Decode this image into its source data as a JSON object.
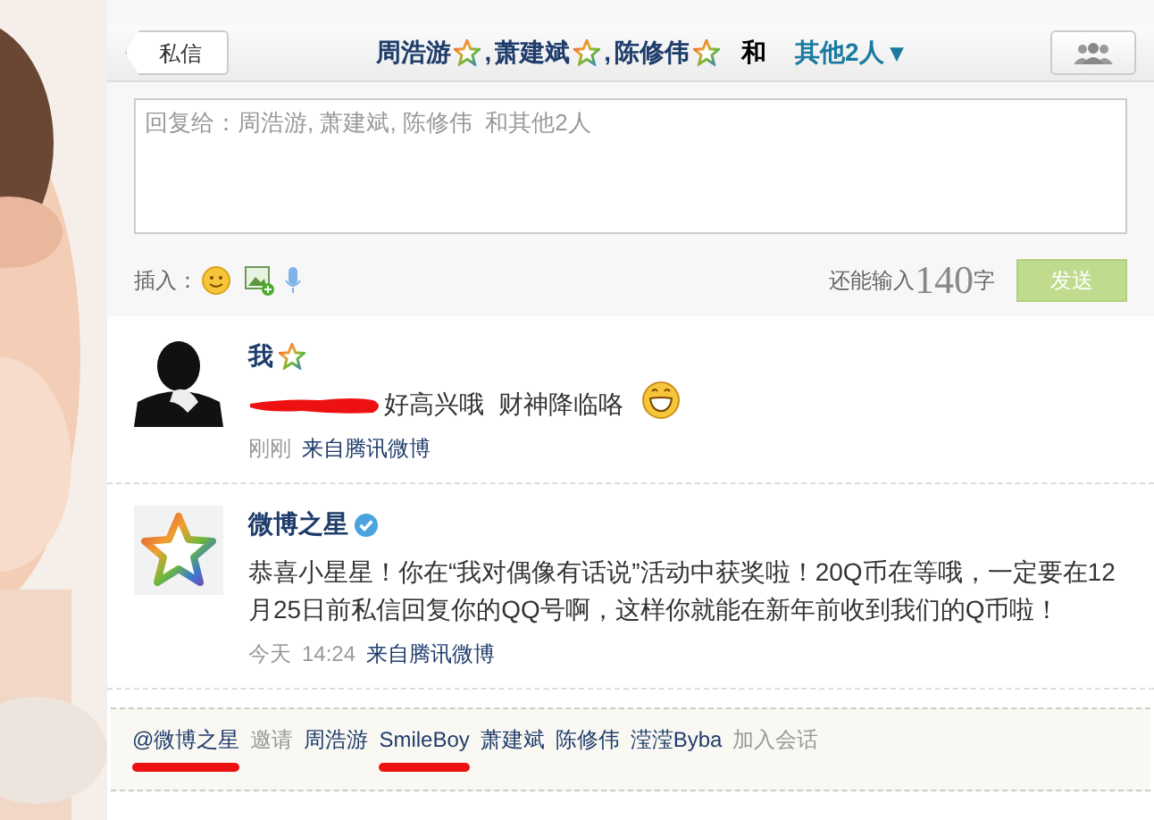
{
  "header": {
    "back_button": "私信",
    "participants": [
      {
        "name": "周浩游",
        "separator": ","
      },
      {
        "name": "萧建斌",
        "separator": ","
      },
      {
        "name": "陈修伟"
      }
    ],
    "conjunction": "和",
    "others": "其他2人",
    "others_caret": "▾"
  },
  "compose": {
    "placeholder": "回复给：周浩游, 萧建斌, 陈修伟  和其他2人",
    "insert_label": "插入：",
    "counter_prefix": "还能输入",
    "counter": "140",
    "counter_suffix": "字",
    "send": "发送",
    "send_disabled": true
  },
  "messages": [
    {
      "kind": "self",
      "author": "我",
      "verified": false,
      "redacted": true,
      "text": "好高兴哦  财神降临咯",
      "emoji": true,
      "time": "刚刚",
      "source": "来自腾讯微博"
    },
    {
      "kind": "star",
      "author": "微博之星",
      "verified": true,
      "redacted": false,
      "text": "恭喜小星星！你在“我对偶像有话说”活动中获奖啦！20Q币在等哦，一定要在12月25日前私信回复你的QQ号啊，这样你就能在新年前收到我们的Q币啦！",
      "emoji": false,
      "time": "14:24",
      "date": "今天",
      "source": "来自腾讯微博"
    }
  ],
  "members": [
    {
      "kind": "mention",
      "text": "@微博之星",
      "underlined": true
    },
    {
      "kind": "action",
      "text": "邀请",
      "underlined": false
    },
    {
      "kind": "name",
      "text": "周浩游",
      "underlined": false
    },
    {
      "kind": "name",
      "text": "SmileBoy",
      "underlined": true
    },
    {
      "kind": "name",
      "text": "萧建斌",
      "underlined": false
    },
    {
      "kind": "name",
      "text": "陈修伟",
      "underlined": false
    },
    {
      "kind": "name",
      "text": "滢滢Byba",
      "underlined": false
    },
    {
      "kind": "action",
      "text": "加入会话",
      "underlined": false
    }
  ]
}
